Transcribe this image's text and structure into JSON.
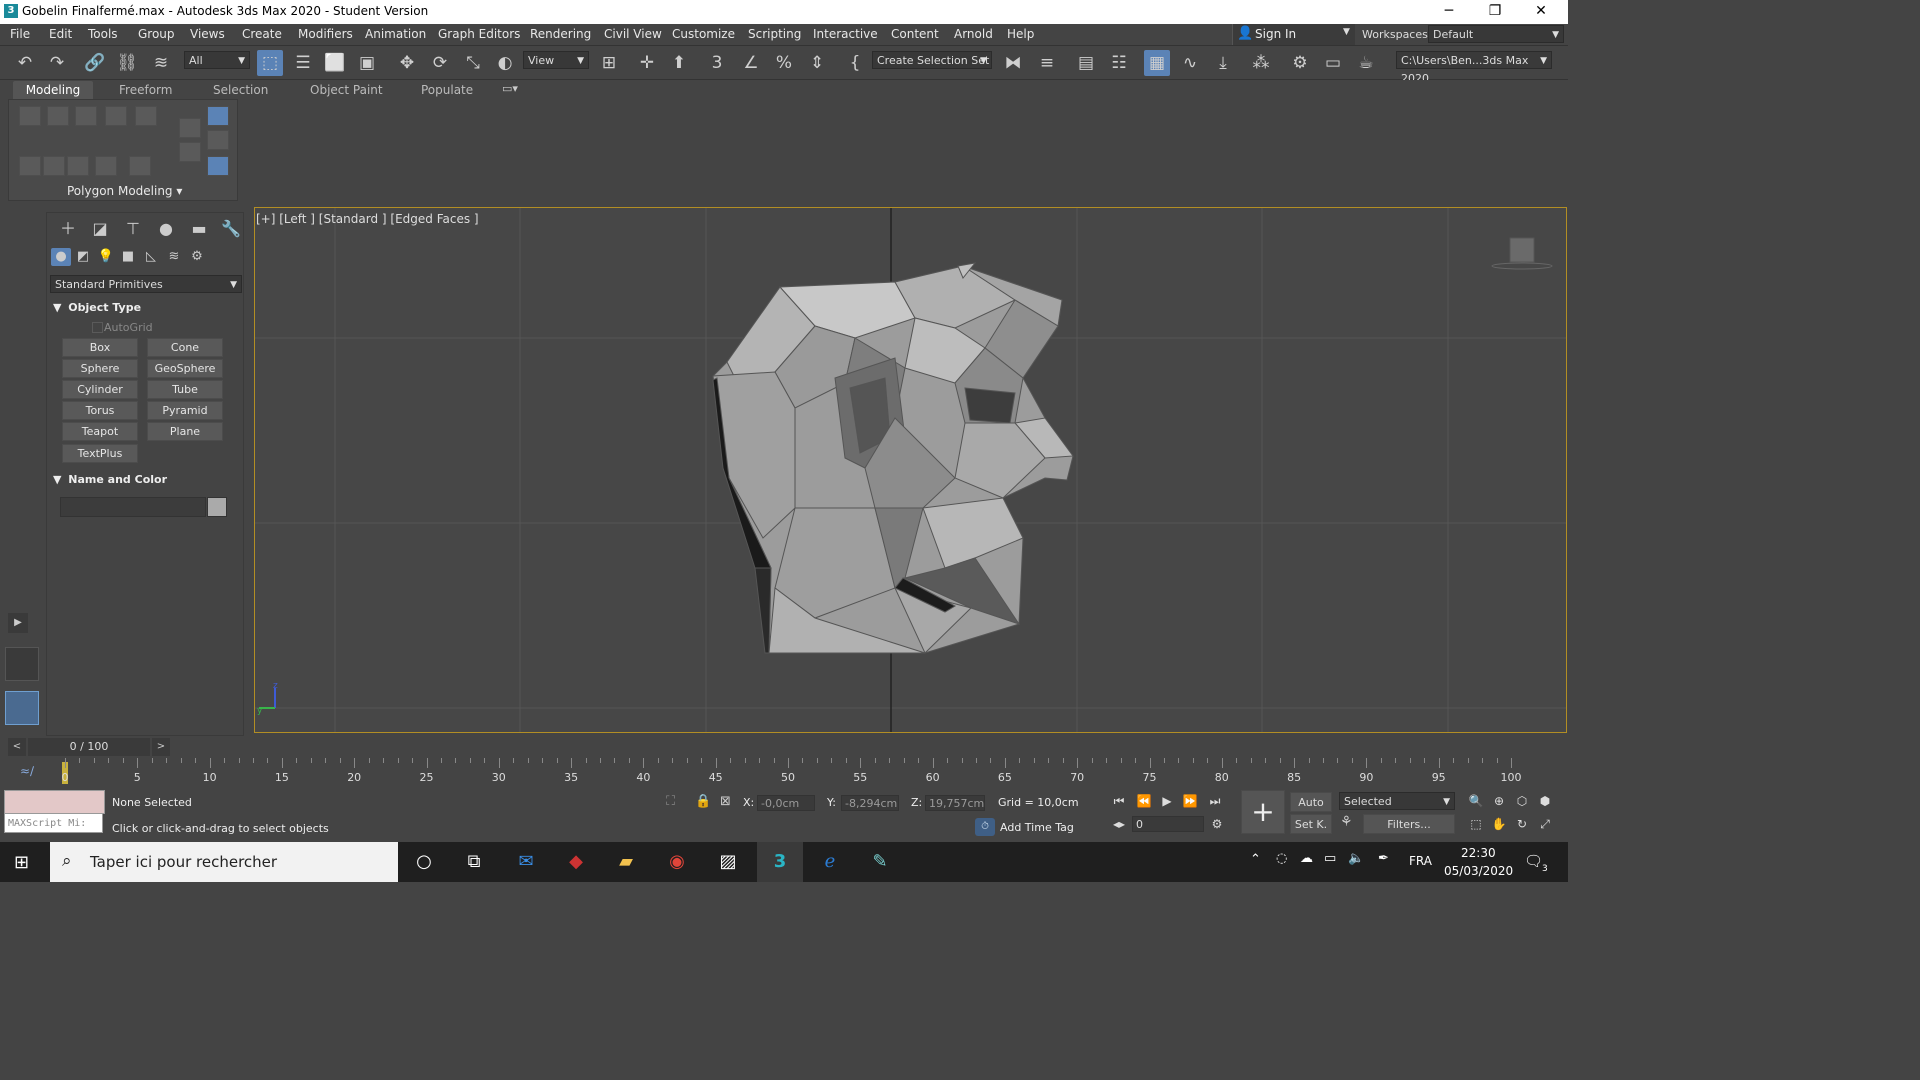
{
  "window": {
    "title": "Gobelin Finalfermé.max - Autodesk 3ds Max 2020 - Student Version",
    "app_icon": "3",
    "controls": [
      "─",
      "❐",
      "✕"
    ]
  },
  "menu": [
    "File",
    "Edit",
    "Tools",
    "Group",
    "Views",
    "Create",
    "Modifiers",
    "Animation",
    "Graph Editors",
    "Rendering",
    "Civil View",
    "Customize",
    "Scripting",
    "Interactive",
    "Content",
    "Arnold",
    "Help"
  ],
  "signin": {
    "label": "Sign In"
  },
  "workspaces": {
    "label": "Workspaces:",
    "value": "Default"
  },
  "toolbar": {
    "filter_value": "All",
    "ref_coord_value": "View",
    "selection_set_value": "Create Selection Set",
    "project_path": "C:\\Users\\Ben...3ds Max 2020"
  },
  "ribbon": {
    "tabs": [
      "Modeling",
      "Freeform",
      "Selection",
      "Object Paint",
      "Populate"
    ],
    "panel_label": "Polygon Modeling"
  },
  "command_panel": {
    "category_value": "Standard Primitives",
    "object_type_title": "Object Type",
    "autogrid_label": "AutoGrid",
    "buttons": [
      "Box",
      "Cone",
      "Sphere",
      "GeoSphere",
      "Cylinder",
      "Tube",
      "Torus",
      "Pyramid",
      "Teapot",
      "Plane",
      "TextPlus"
    ],
    "name_color_title": "Name and Color",
    "name_value": ""
  },
  "viewport": {
    "label": "[+] [Left ] [Standard ] [Edged Faces ]",
    "axis_labels": [
      "z",
      "y"
    ]
  },
  "timeline": {
    "slider_value": "0 / 100",
    "ticks": [
      "0",
      "5",
      "10",
      "15",
      "20",
      "25",
      "30",
      "35",
      "40",
      "45",
      "50",
      "55",
      "60",
      "65",
      "70",
      "75",
      "80",
      "85",
      "90",
      "95",
      "100"
    ]
  },
  "status": {
    "maxscript_placeholder": "MAXScript Mi:",
    "selection_status": "None Selected",
    "prompt": "Click or click-and-drag to select objects",
    "x_label": "X:",
    "x_value": "-0,0cm",
    "y_label": "Y:",
    "y_value": "-8,294cm",
    "z_label": "Z:",
    "z_value": "19,757cm",
    "grid": "Grid = 10,0cm",
    "add_time_tag": "Add Time Tag",
    "frame_value": "0",
    "auto_key": "Auto",
    "set_key": "Set K.",
    "selected_dropdown": "Selected",
    "filters": "Filters..."
  },
  "taskbar": {
    "search_placeholder": "Taper ici pour rechercher",
    "language": "FRA",
    "time": "22:30",
    "date": "05/03/2020",
    "notif_count": "3"
  },
  "colors": {
    "ui_bg": "#444444",
    "viewport_bg": "#474747",
    "viewport_border": "#b28e24",
    "active_tool": "#5b83b6"
  }
}
